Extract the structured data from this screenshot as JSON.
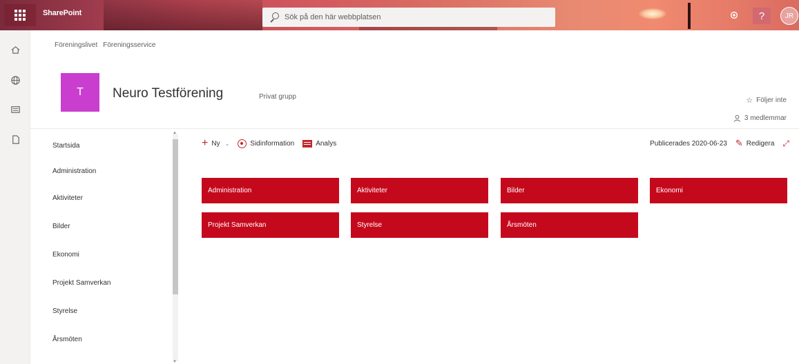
{
  "suite": {
    "brand": "SharePoint",
    "search_placeholder": "Sök på den här webbplatsen",
    "help": "?",
    "avatar": "JR"
  },
  "breadcrumb": [
    "Föreningslivet",
    "Föreningsservice"
  ],
  "site": {
    "logo_letter": "T",
    "title": "Neuro Testförening",
    "subtitle": "Privat grupp",
    "follow": "Följer inte",
    "members": "3 medlemmar"
  },
  "leftnav": {
    "items": [
      "Startsida",
      "Administration",
      "Aktiviteter",
      "Bilder",
      "Ekonomi",
      "Projekt Samverkan",
      "Styrelse",
      "Årsmöten"
    ]
  },
  "commandbar": {
    "new": "Ny",
    "page_details": "Sidinformation",
    "analytics": "Analys",
    "published": "Publicerades 2020-06-23",
    "edit": "Redigera"
  },
  "tiles": [
    "Administration",
    "Aktiviteter",
    "Bilder",
    "Ekonomi",
    "Projekt Samverkan",
    "Styrelse",
    "Årsmöten"
  ],
  "colors": {
    "tile": "#c5091d",
    "logo": "#c93ecf",
    "accent": "#c4262e"
  }
}
